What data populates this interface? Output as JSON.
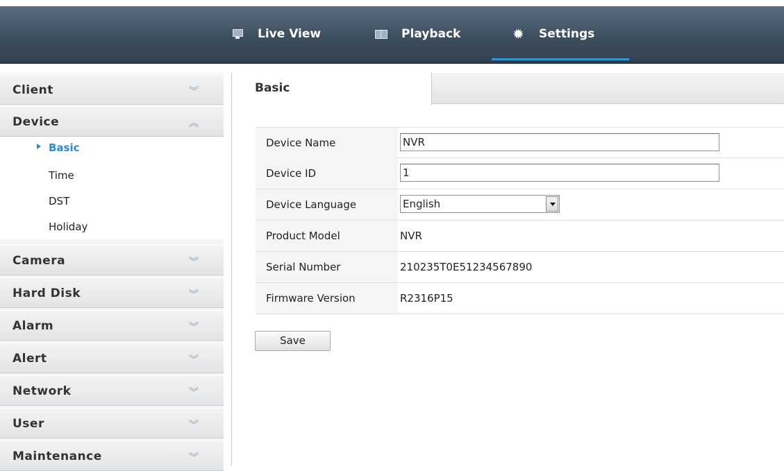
{
  "nav": {
    "items": [
      {
        "label": "Live View",
        "icon": "monitor-icon"
      },
      {
        "label": "Playback",
        "icon": "playback-icon"
      },
      {
        "label": "Settings",
        "icon": "gear-icon",
        "active": true
      }
    ]
  },
  "sidebar": {
    "sections": [
      {
        "label": "Client",
        "expanded": false
      },
      {
        "label": "Device",
        "expanded": true
      },
      {
        "label": "Camera",
        "expanded": false
      },
      {
        "label": "Hard Disk",
        "expanded": false
      },
      {
        "label": "Alarm",
        "expanded": false
      },
      {
        "label": "Alert",
        "expanded": false
      },
      {
        "label": "Network",
        "expanded": false
      },
      {
        "label": "User",
        "expanded": false
      },
      {
        "label": "Maintenance",
        "expanded": false
      }
    ],
    "device_items": [
      {
        "label": "Basic",
        "active": true
      },
      {
        "label": "Time"
      },
      {
        "label": "DST"
      },
      {
        "label": "Holiday"
      }
    ]
  },
  "main": {
    "tab": "Basic",
    "fields": {
      "device_name": {
        "label": "Device Name",
        "value": "NVR"
      },
      "device_id": {
        "label": "Device ID",
        "value": "1"
      },
      "device_language": {
        "label": "Device Language",
        "value": "English"
      },
      "product_model": {
        "label": "Product Model",
        "value": "NVR"
      },
      "serial_number": {
        "label": "Serial Number",
        "value": "210235T0E51234567890"
      },
      "firmware_version": {
        "label": "Firmware Version",
        "value": "R2316P15"
      }
    },
    "save_label": "Save"
  },
  "colors": {
    "topbar": "#3d4e5f",
    "accent": "#2e95d3",
    "active_link": "#2a8bd0"
  }
}
